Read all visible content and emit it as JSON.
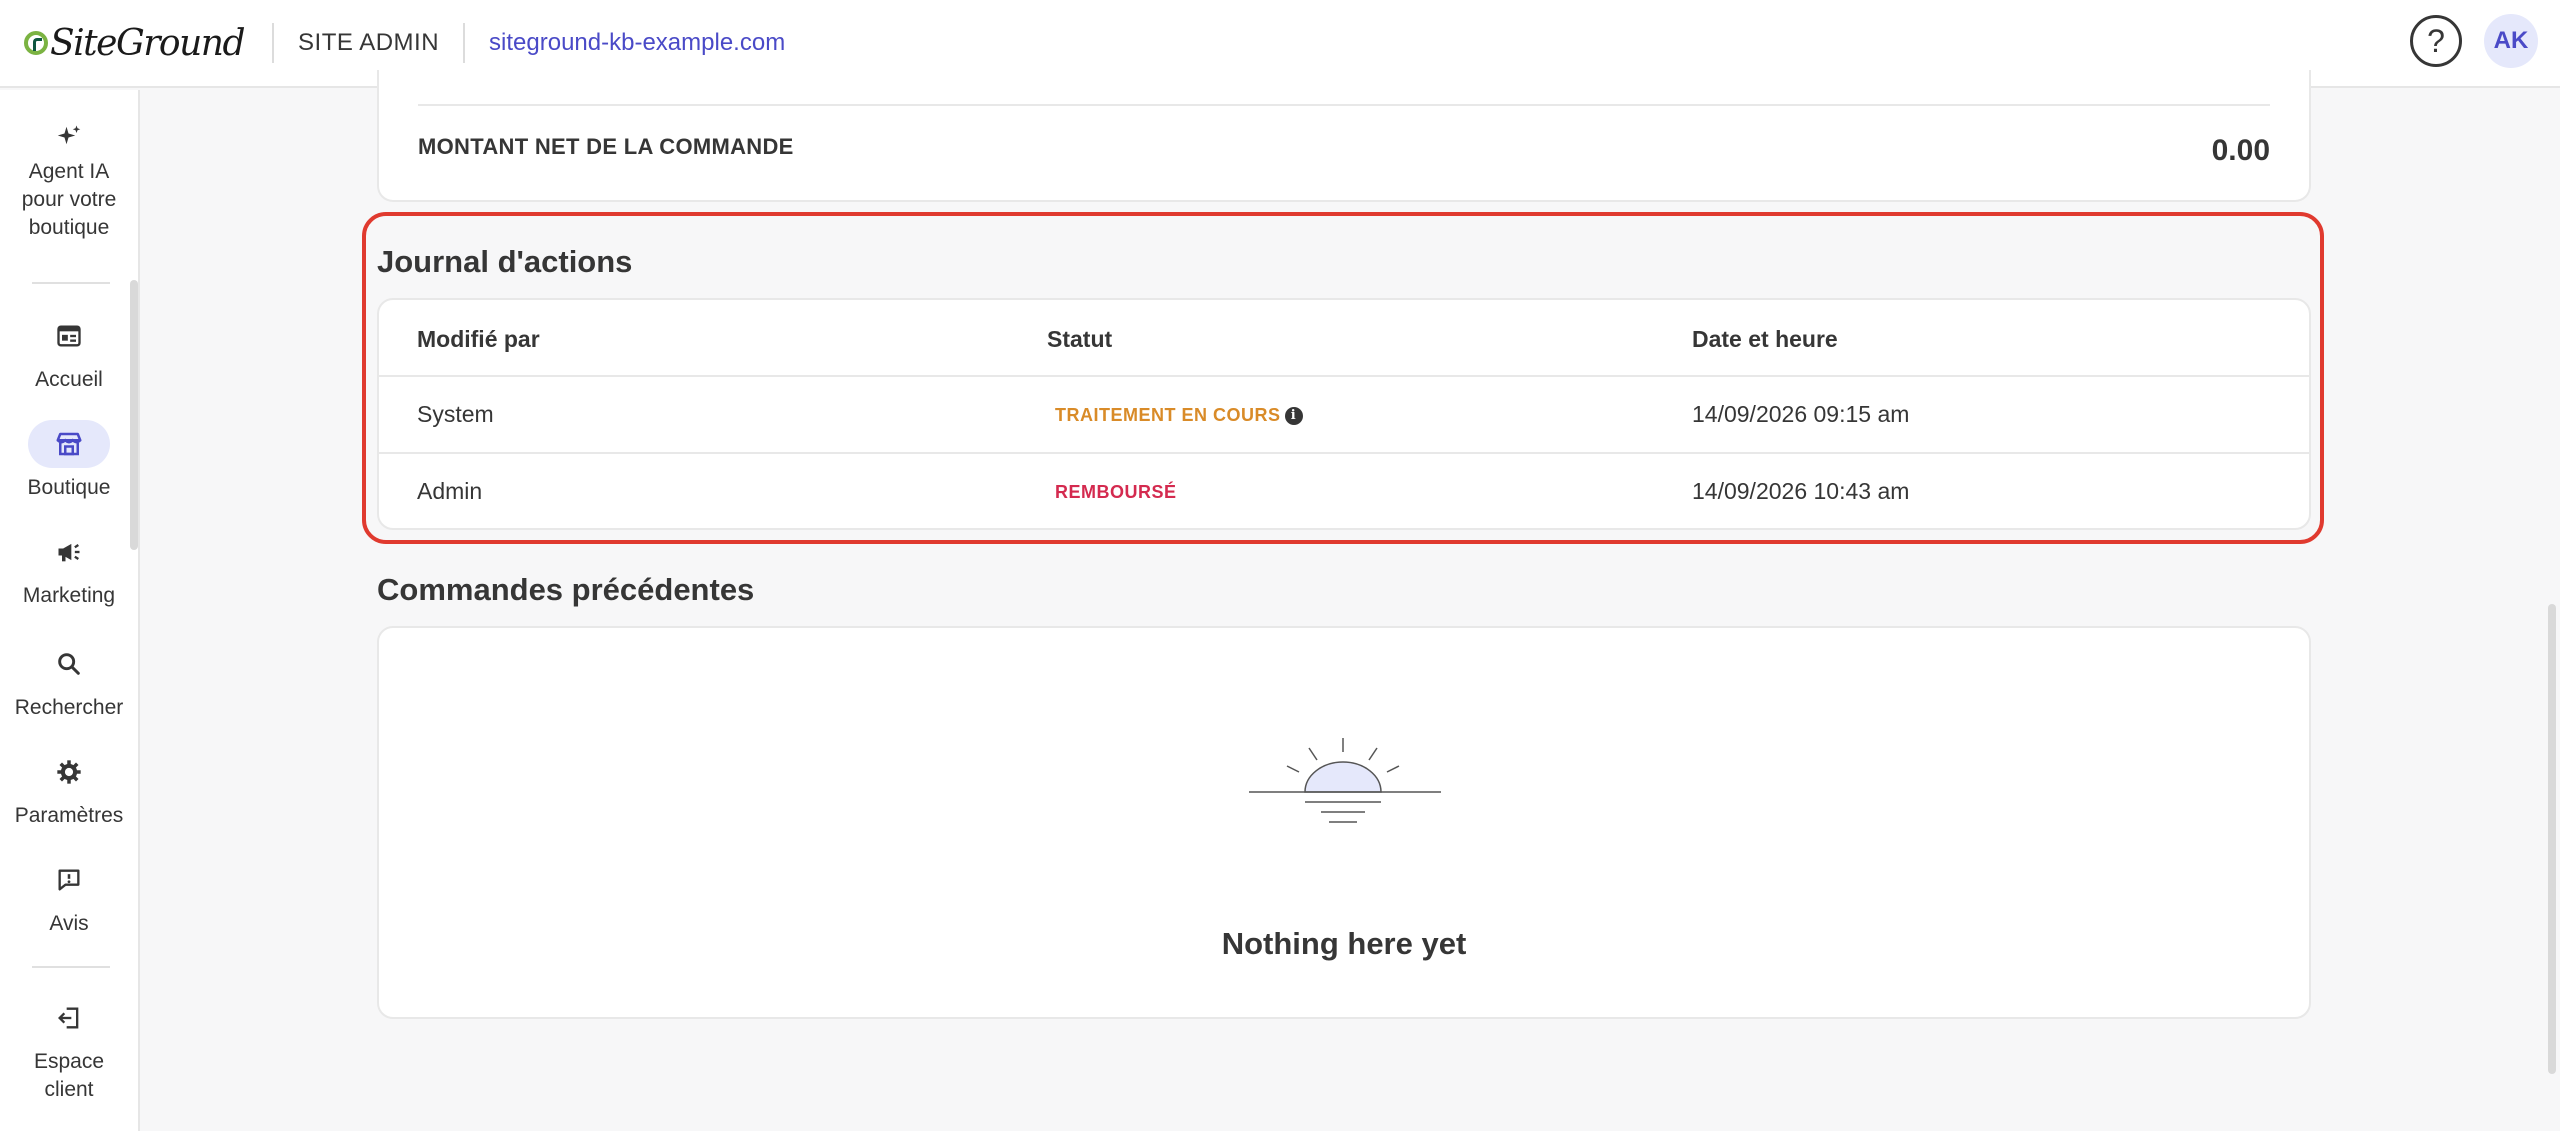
{
  "header": {
    "logo_text": "SiteGround",
    "site_admin_label": "SITE ADMIN",
    "site_link": "siteground-kb-example.com",
    "help_label": "?",
    "avatar_initials": "AK"
  },
  "sidebar": {
    "items": [
      {
        "label": "Agent IA pour votre boutique",
        "icon": "sparkle-icon"
      },
      {
        "label": "Accueil",
        "icon": "dashboard-icon"
      },
      {
        "label": "Boutique",
        "icon": "store-icon",
        "active": true
      },
      {
        "label": "Marketing",
        "icon": "megaphone-icon"
      },
      {
        "label": "Rechercher",
        "icon": "search-icon"
      },
      {
        "label": "Paramètres",
        "icon": "gear-icon"
      },
      {
        "label": "Avis",
        "icon": "review-icon"
      },
      {
        "label": "Espace client",
        "icon": "logout-icon"
      }
    ]
  },
  "order_summary": {
    "net_amount_label": "MONTANT NET DE LA COMMANDE",
    "net_amount_value": "0.00"
  },
  "action_log": {
    "title": "Journal d'actions",
    "columns": [
      "Modifié par",
      "Statut",
      "Date et heure"
    ],
    "rows": [
      {
        "modified_by": "System",
        "status": "TRAITEMENT EN COURS",
        "datetime": "14/09/2026 09:15 am"
      },
      {
        "modified_by": "Admin",
        "status": "REMBOURSÉ",
        "datetime": "14/09/2026 10:43 am"
      }
    ]
  },
  "previous_orders": {
    "title": "Commandes précédentes",
    "empty_message": "Nothing here yet"
  },
  "colors": {
    "accent": "#4a4ac7",
    "highlight": "#e03a2f",
    "status_processing": "#d98b28",
    "status_refunded": "#d42a4f"
  }
}
